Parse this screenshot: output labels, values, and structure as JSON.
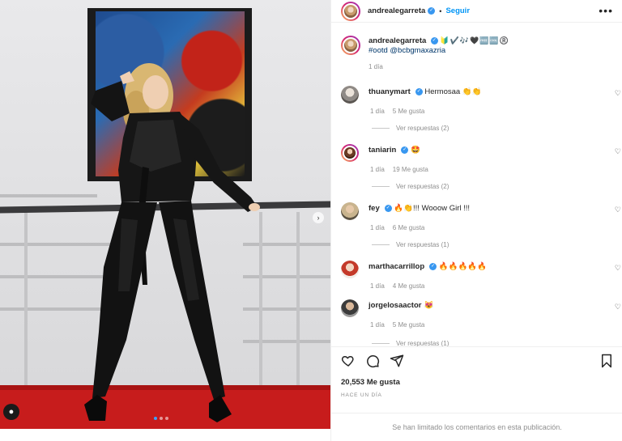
{
  "post": {
    "author": "andrealegarreta",
    "follow_label": "Seguir",
    "more_icon": "more-horizontal-icon",
    "separator": "•"
  },
  "caption": {
    "username": "andrealegarreta",
    "emojis": "🔰✔️🎶🖤🆓🆒®️",
    "hashtags": "#ootd @bcbgmaxazria",
    "time": "1 día"
  },
  "comments": [
    {
      "username": "thuanymart",
      "text": "Hermosaa 👏👏",
      "time": "1 día",
      "likes": "5 Me gusta",
      "replies": "Ver respuestas (2)",
      "verified": true
    },
    {
      "username": "taniarin",
      "text": "🤩",
      "time": "1 día",
      "likes": "19 Me gusta",
      "replies": "Ver respuestas (2)",
      "verified": true
    },
    {
      "username": "fey",
      "text": "🔥👏!!! Wooow Girl !!!",
      "time": "1 día",
      "likes": "6 Me gusta",
      "replies": "Ver respuestas (1)",
      "verified": true
    },
    {
      "username": "marthacarrillop",
      "text": "🔥🔥🔥🔥🔥",
      "time": "1 día",
      "likes": "4 Me gusta",
      "replies": "",
      "verified": true
    },
    {
      "username": "jorgelosaactor",
      "text": "😻",
      "time": "1 día",
      "likes": "5 Me gusta",
      "replies": "Ver respuestas (1)",
      "verified": false
    }
  ],
  "actions": {
    "like_icon": "heart-icon",
    "comment_icon": "comment-icon",
    "share_icon": "share-icon",
    "save_icon": "bookmark-icon",
    "likes_count": "20,553 Me gusta",
    "date": "HACE UN DÍA"
  },
  "footer": {
    "notice": "Se han limitado los comentarios en esta publicación."
  },
  "colors": {
    "accent": "#0095f6",
    "verified": "#3897f0",
    "muted": "#8e8e8e"
  }
}
